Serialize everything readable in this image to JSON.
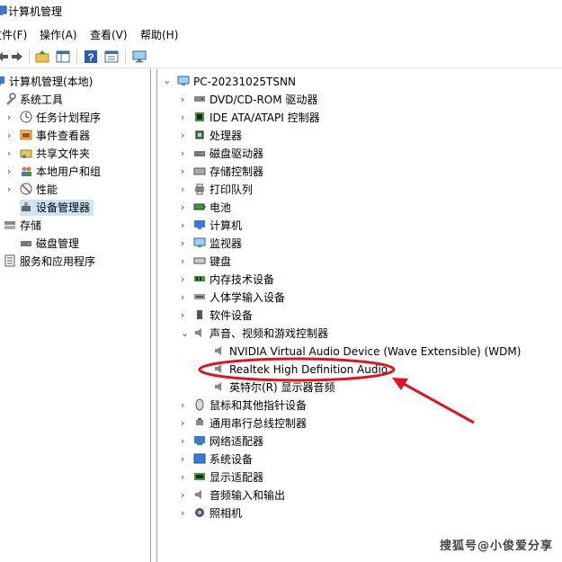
{
  "window": {
    "title": "计算机管理"
  },
  "menu": [
    {
      "label": "文件(F)"
    },
    {
      "label": "操作(A)"
    },
    {
      "label": "查看(V)"
    },
    {
      "label": "帮助(H)"
    }
  ],
  "toolbar": {
    "icons": [
      "back-arrow-icon",
      "forward-arrow-icon",
      "up-folder-icon",
      "show-hide-pane-icon",
      "help-icon",
      "properties-icon",
      "monitor-icon"
    ]
  },
  "left_tree": {
    "root": "计算机管理(本地)",
    "system_tools": "系统工具",
    "items": [
      {
        "label": "任务计划程序"
      },
      {
        "label": "事件查看器"
      },
      {
        "label": "共享文件夹"
      },
      {
        "label": "本地用户和组"
      },
      {
        "label": "性能"
      },
      {
        "label": "设备管理器"
      }
    ],
    "storage": "存储",
    "disk_mgmt": "磁盘管理",
    "services": "服务和应用程序"
  },
  "device_tree": {
    "computer": "PC-20231025TSNN",
    "categories": [
      {
        "label": "DVD/CD-ROM 驱动器"
      },
      {
        "label": "IDE ATA/ATAPI 控制器"
      },
      {
        "label": "处理器"
      },
      {
        "label": "磁盘驱动器"
      },
      {
        "label": "存储控制器"
      },
      {
        "label": "打印队列"
      },
      {
        "label": "电池"
      },
      {
        "label": "计算机"
      },
      {
        "label": "监视器"
      },
      {
        "label": "键盘"
      },
      {
        "label": "内存技术设备"
      },
      {
        "label": "人体学输入设备"
      },
      {
        "label": "软件设备"
      },
      {
        "label": "声音、视频和游戏控制器"
      }
    ],
    "audio_children": [
      {
        "label": "NVIDIA Virtual Audio Device (Wave Extensible) (WDM)"
      },
      {
        "label": "Realtek High Definition Audio"
      },
      {
        "label": "英特尔(R) 显示器音频"
      }
    ],
    "categories_after": [
      {
        "label": "鼠标和其他指针设备"
      },
      {
        "label": "通用串行总线控制器"
      },
      {
        "label": "网络适配器"
      },
      {
        "label": "系统设备"
      },
      {
        "label": "显示适配器"
      },
      {
        "label": "音频输入和输出"
      },
      {
        "label": "照相机"
      }
    ]
  },
  "watermark": "搜狐号@小俊爱分享",
  "colors": {
    "selection": "#cce4f7",
    "annotation": "#e0141e"
  }
}
